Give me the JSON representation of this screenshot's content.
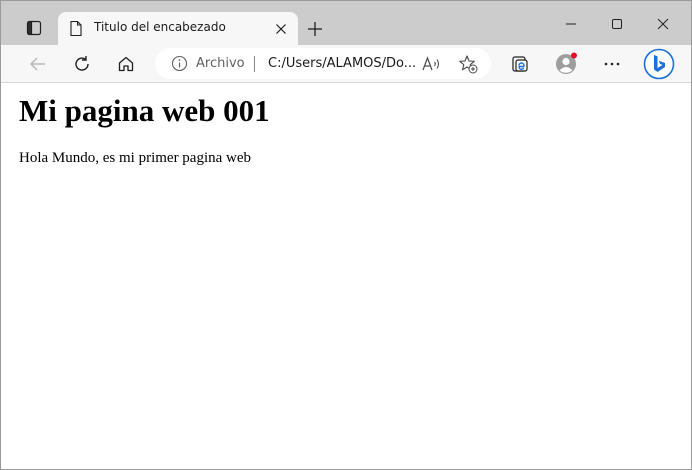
{
  "tab": {
    "title": "Titulo del encabezado",
    "icon": "page-icon"
  },
  "titlebar": {
    "buttons": [
      "tab-actions-icon",
      "new-tab-icon",
      "minimize-icon",
      "maximize-icon",
      "close-icon"
    ]
  },
  "toolbar": {
    "icons": [
      "back-icon",
      "reload-icon",
      "home-icon",
      "collections-icon",
      "profile-icon",
      "more-icon",
      "bing-icon"
    ]
  },
  "address_bar": {
    "site_label": "Archivo",
    "url": "C:/Users/ALAMOS/Do...",
    "icons": [
      "info-icon",
      "read-aloud-icon",
      "add-favorite-icon"
    ]
  },
  "page": {
    "heading": "Mi pagina web 001",
    "paragraph": "Hola Mundo, es mi primer pagina web"
  },
  "colors": {
    "tabstrip_bg": "#cccccc",
    "toolbar_bg": "#f7f7f7",
    "profile_notification_dot": "#e81123",
    "bing_blue": "#1e6fd9"
  }
}
